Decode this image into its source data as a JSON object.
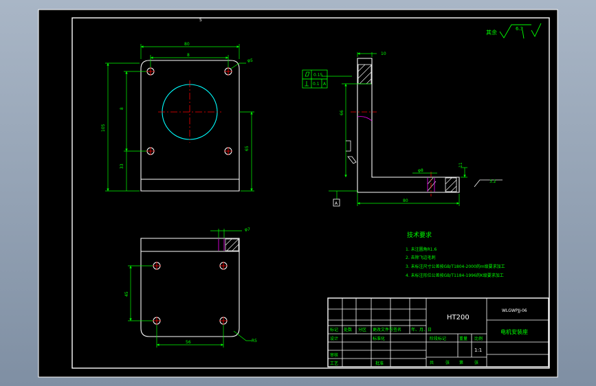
{
  "colors": {
    "background": "#000000",
    "frame": "#ffffff",
    "outline": "#ffffff",
    "dimension": "#00ff00",
    "centerline": "#ff0000",
    "hidden": "#ff00ff",
    "text": "#00ff00",
    "circle": "#00ffff"
  },
  "top_mark": "5",
  "roughness_note": {
    "prefix": "其余",
    "value": "6.3"
  },
  "front_view": {
    "width_dim": "80",
    "hole_spacing": "8",
    "height_dim": "105",
    "left_inner": "8",
    "lower_offset": "33",
    "right_dim": "65",
    "corner_hole": "φ5"
  },
  "side_view": {
    "thickness": "10",
    "flatness": "0.15",
    "perpendicularity": "0.1",
    "datum": "A",
    "height_dim": "66",
    "hole_dia": "φ8",
    "base_thick": "11",
    "base_len": "80",
    "roughness": "3.2",
    "datum_label": "A"
  },
  "bottom_view": {
    "hole_dia": "φ7",
    "vertical_spacing": "45",
    "horizontal_spacing": "56",
    "corner_radius": "R5"
  },
  "tech_requirements": {
    "title": "技术要求",
    "items": [
      "1. 未注圆角R1.6",
      "2. 去除飞边毛刺",
      "3. 未标注尺寸公差按GB/T1804-2000的m级要求加工",
      "4. 未标注形位公差按GB/T1184-1996的K级要求加工"
    ]
  },
  "title_block": {
    "material": "HT200",
    "drawing_no": "WLGWPJJ-06",
    "part_name": "电机安装座",
    "scale": "1:1",
    "headers": [
      "标记",
      "处数",
      "分区",
      "更改文件号",
      "签名",
      "年、月、日"
    ],
    "design": "设计",
    "standardize": "标准化",
    "review": "审核",
    "process": "工艺",
    "approve": "批准",
    "stage_mark": "阶段标记",
    "weight": "重量",
    "ratio": "比例",
    "sheet_total": "共",
    "sheet_unit1": "张",
    "sheet_nth": "第",
    "sheet_unit2": "张"
  }
}
